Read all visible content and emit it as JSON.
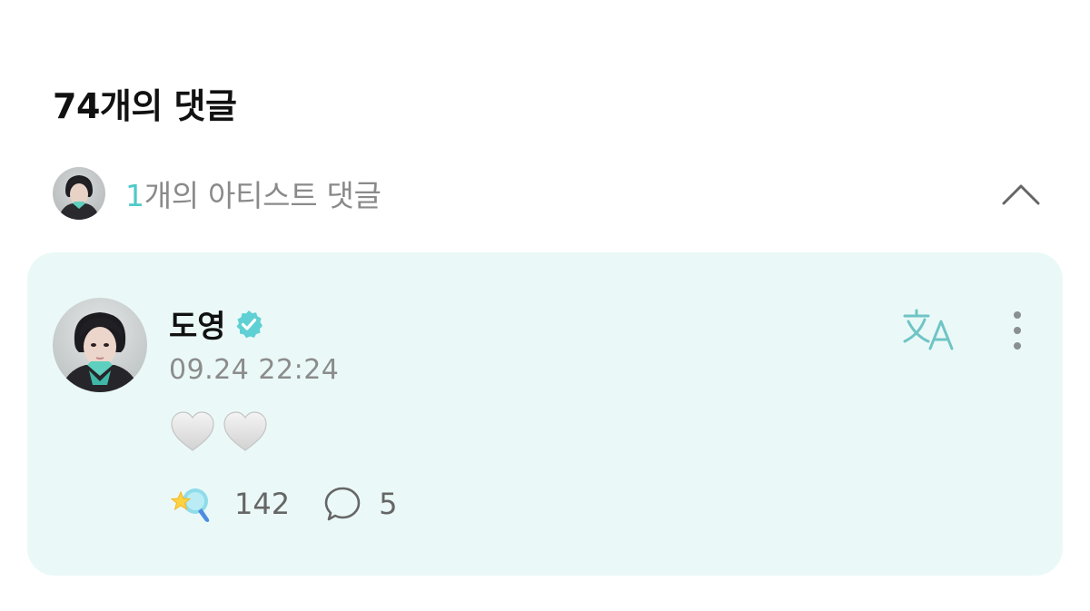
{
  "comments_header": {
    "count_text": "74개의 댓글"
  },
  "artist_section": {
    "count": "1",
    "label_suffix": "개의 아티스트 댓글",
    "collapse_icon": "chevron-up-icon"
  },
  "comment": {
    "author": "도영",
    "verified_icon": "verified-badge-icon",
    "timestamp": "09.24 22:24",
    "body_icons": [
      "white-heart-icon",
      "white-heart-icon"
    ],
    "like_count": "142",
    "reply_count": "5",
    "translate_icon": "translate-icon",
    "more_icon": "more-vertical-icon"
  },
  "colors": {
    "accent": "#4fc9c9",
    "card_background": "#eaf9f7",
    "muted_text": "#8c8c8c"
  }
}
